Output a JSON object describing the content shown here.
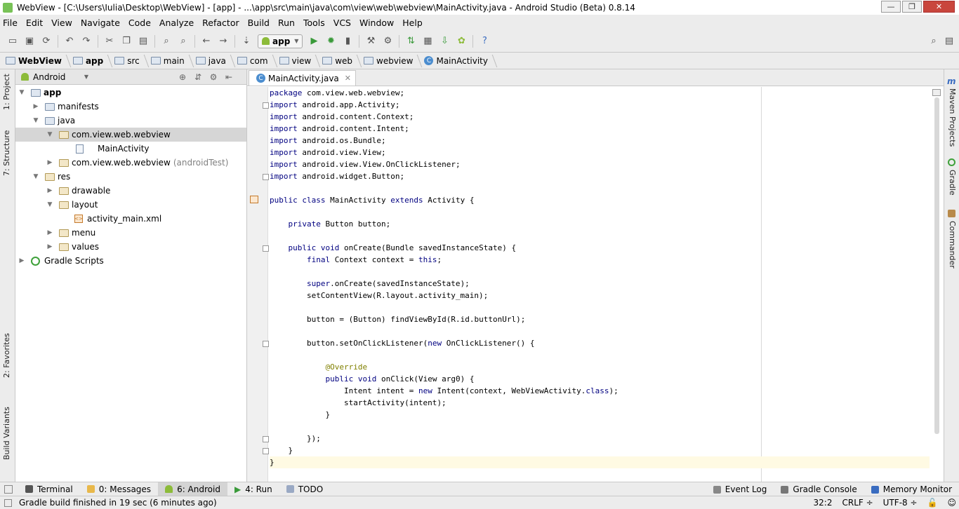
{
  "window": {
    "title": "WebView - [C:\\Users\\Iulia\\Desktop\\WebView] - [app] - ...\\app\\src\\main\\java\\com\\view\\web\\webview\\MainActivity.java - Android Studio (Beta) 0.8.14",
    "minimize": "—",
    "maximize": "❐",
    "close": "✕"
  },
  "menu": [
    "File",
    "Edit",
    "View",
    "Navigate",
    "Code",
    "Analyze",
    "Refactor",
    "Build",
    "Run",
    "Tools",
    "VCS",
    "Window",
    "Help"
  ],
  "toolbar": {
    "run_config": "app"
  },
  "breadcrumbs": [
    "WebView",
    "app",
    "src",
    "main",
    "java",
    "com",
    "view",
    "web",
    "webview",
    "MainActivity"
  ],
  "left_tabs": {
    "project": "1: Project",
    "structure": "7: Structure",
    "favorites": "2: Favorites",
    "build_variants": "Build Variants"
  },
  "right_tabs": {
    "maven": "Maven Projects",
    "gradle": "Gradle",
    "commander": "Commander"
  },
  "project_panel": {
    "view_selector": "Android",
    "tree": [
      {
        "label": "app",
        "bold": true,
        "suffix": ""
      },
      {
        "label": "manifests",
        "bold": false,
        "suffix": ""
      },
      {
        "label": "java",
        "bold": false,
        "suffix": ""
      },
      {
        "label": "com.view.web.webview",
        "bold": false,
        "suffix": ""
      },
      {
        "label": "MainActivity",
        "bold": false,
        "suffix": ""
      },
      {
        "label": "com.view.web.webview",
        "bold": false,
        "suffix": "(androidTest)"
      },
      {
        "label": "res",
        "bold": false,
        "suffix": ""
      },
      {
        "label": "drawable",
        "bold": false,
        "suffix": ""
      },
      {
        "label": "layout",
        "bold": false,
        "suffix": ""
      },
      {
        "label": "activity_main.xml",
        "bold": false,
        "suffix": ""
      },
      {
        "label": "menu",
        "bold": false,
        "suffix": ""
      },
      {
        "label": "values",
        "bold": false,
        "suffix": ""
      },
      {
        "label": "Gradle Scripts",
        "bold": false,
        "suffix": ""
      }
    ]
  },
  "editor": {
    "tab_label": "MainActivity.java",
    "code_lines": [
      "package com.view.web.webview;",
      "import android.app.Activity;",
      "import android.content.Context;",
      "import android.content.Intent;",
      "import android.os.Bundle;",
      "import android.view.View;",
      "import android.view.View.OnClickListener;",
      "import android.widget.Button;",
      "",
      "public class MainActivity extends Activity {",
      "",
      "    private Button button;",
      "",
      "    public void onCreate(Bundle savedInstanceState) {",
      "        final Context context = this;",
      "",
      "        super.onCreate(savedInstanceState);",
      "        setContentView(R.layout.activity_main);",
      "",
      "        button = (Button) findViewById(R.id.buttonUrl);",
      "",
      "        button.setOnClickListener(new OnClickListener() {",
      "",
      "            @Override",
      "            public void onClick(View arg0) {",
      "                Intent intent = new Intent(context, WebViewActivity.class);",
      "                startActivity(intent);",
      "            }",
      "",
      "        });",
      "    }",
      "}"
    ]
  },
  "bottom_tabs": {
    "terminal": "Terminal",
    "messages": "0: Messages",
    "android": "6: Android",
    "run": "4: Run",
    "todo": "TODO",
    "event_log": "Event Log",
    "gradle_console": "Gradle Console",
    "memory_monitor": "Memory Monitor"
  },
  "status": {
    "message": "Gradle build finished in 19 sec (6 minutes ago)",
    "position": "32:2",
    "line_sep": "CRLF ÷",
    "encoding": "UTF-8 ÷"
  }
}
